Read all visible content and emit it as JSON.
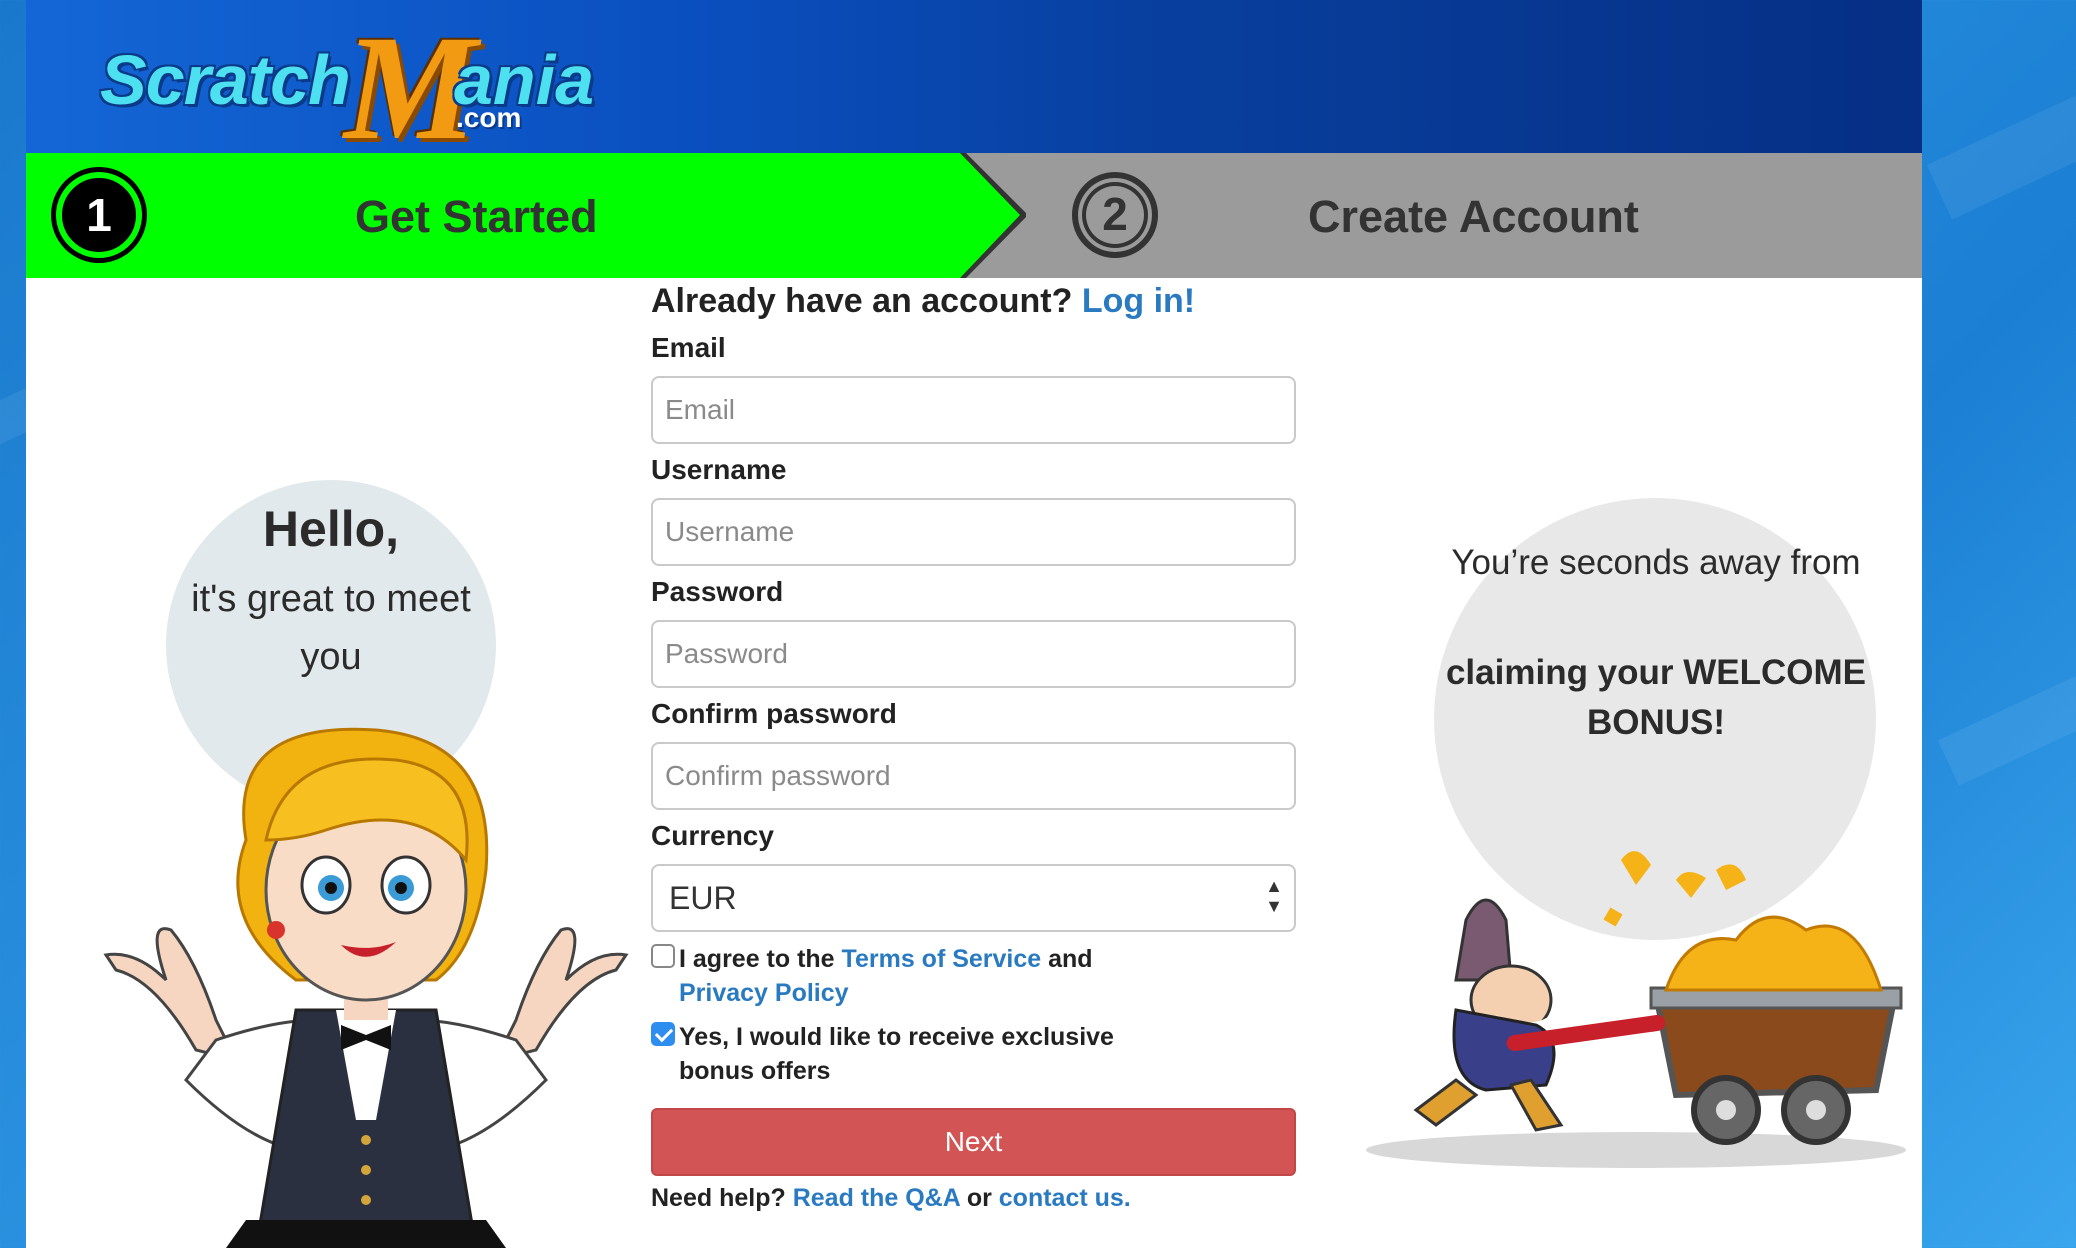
{
  "header": {
    "logo_scratch": "Scratch",
    "logo_m": "M",
    "logo_ania": "ania",
    "logo_com": ".com"
  },
  "steps": [
    {
      "number": "1",
      "label": "Get Started",
      "active": true
    },
    {
      "number": "2",
      "label": "Create Account",
      "active": false
    }
  ],
  "colors": {
    "active_step": "#00ff00",
    "inactive_step": "#9b9b9b",
    "header_blue": "#0a4fc0",
    "link": "#2a7ac2",
    "next_button": "#d25454",
    "checkbox_on": "#2d8ef0"
  },
  "login": {
    "prompt": "Already have an account?",
    "link": "Log in!"
  },
  "form": {
    "email": {
      "label": "Email",
      "placeholder": "Email",
      "value": ""
    },
    "username": {
      "label": "Username",
      "placeholder": "Username",
      "value": ""
    },
    "password": {
      "label": "Password",
      "placeholder": "Password",
      "value": ""
    },
    "confirm": {
      "label": "Confirm password",
      "placeholder": "Confirm password",
      "value": ""
    },
    "currency": {
      "label": "Currency",
      "value": "EUR",
      "arrow_up": "▲",
      "arrow_down": "▼"
    },
    "terms": {
      "checked": false,
      "text_before": "I agree to the ",
      "tos_link": "Terms of Service",
      "text_mid": " and",
      "privacy_link": "Privacy Policy"
    },
    "offers": {
      "checked": true,
      "text": "Yes, I would like to receive exclusive bonus offers"
    },
    "next_label": "Next",
    "help": {
      "prompt": "Need help?",
      "qa_link": "Read the Q&A",
      "or": "or",
      "contact_link": "contact us."
    }
  },
  "left_bubble": {
    "title": "Hello,",
    "subtitle": "it's great to meet you"
  },
  "right_bubble": {
    "line1": "You’re seconds away from",
    "line2": "claiming your WELCOME BONUS!"
  },
  "icons": {
    "mascot": "hostess-character",
    "miner": "miner-with-gold-cart"
  }
}
